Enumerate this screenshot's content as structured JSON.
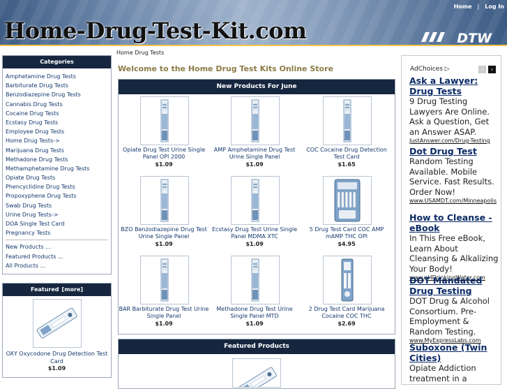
{
  "header": {
    "logo": "Home-Drug-Test-Kit.com",
    "links": [
      "Home",
      "Log In"
    ],
    "separator": "|",
    "brand_mark": "DTW"
  },
  "sidebar": {
    "categories_title": "Categories",
    "categories": [
      "Amphetamine Drug Tests",
      "Barbiturate Drug Tests",
      "Benzodiazepine Drug Tests",
      "Cannabis Drug Tests",
      "Cocaine Drug Tests",
      "Ecstasy Drug Tests",
      "Employee Drug Tests",
      "Home Drug Tests->",
      "Marijuana Drug Tests",
      "Methadone Drug Tests",
      "Methamphetamine Drug Tests",
      "Opiate Drug Tests",
      "Phencyclidine Drug Tests",
      "Propoxyphene Drug Tests",
      "Swab Drug Tests",
      "Urine Drug Tests->",
      "DOA Single Test Card",
      "Pregnancy Tests"
    ],
    "extra_links": [
      "New Products ...",
      "Featured Products ...",
      "All Products ..."
    ],
    "featured_title": "Featured",
    "featured_more": "[more]",
    "featured_product": {
      "name": "OXY Oxycodone Drug Detection Test Card",
      "price": "$1.09"
    }
  },
  "main": {
    "breadcrumb": "Home Drug Tests",
    "welcome": "Welcome to the Home Drug Test Kits Online Store",
    "new_products_title": "New Products For June",
    "products": [
      {
        "name": "Opiate Drug Test Urine Single Panel OPI 2000",
        "price": "$1.09"
      },
      {
        "name": "AMP Amphetamine Drug Test Urine Single Panel",
        "price": "$1.09"
      },
      {
        "name": "COC Cocaine Drug Detection Test Card",
        "price": "$1.65"
      },
      {
        "name": "BZO Benzodiazepine Drug Test Urine Single Panel",
        "price": "$1.09"
      },
      {
        "name": "Ecstasy Drug Test Urine Single Panel MDMA XTC",
        "price": "$1.09"
      },
      {
        "name": "5 Drug Test Card COC AMP mAMP THC OPI",
        "price": "$4.95"
      },
      {
        "name": "BAR Barbiturate Drug Test Urine Single Panel",
        "price": "$1.09"
      },
      {
        "name": "Methadone Drug Test Urine Single Panel MTD",
        "price": "$1.09"
      },
      {
        "name": "2 Drug Test Card Marijuana Cocaine COC THC",
        "price": "$2.69"
      }
    ],
    "featured_products_title": "Featured Products"
  },
  "ads": {
    "adchoices": "AdChoices",
    "items": [
      {
        "title": "Ask a Lawyer: Drug Tests",
        "body": "9 Drug Testing Lawyers Are Online. Ask a Question, Get an Answer ASAP.",
        "url": "JustAnswer.com/Drug-Testing"
      },
      {
        "title": "Dot Drug Test",
        "body": "Random Testing Available. Mobile Service. Fast Results. Order Now!",
        "url": "www.USAMDT.com/Minneapolis"
      },
      {
        "title": "How to Cleanse - eBook",
        "body": "In This Free eBook, Learn About Cleansing & Alkalizing Your Body!",
        "url": "www.pHDrinkingWater.com"
      },
      {
        "title": "DOT Mandated Drug Testing",
        "body": "DOT Drug & Alcohol Consortium. Pre-Employment & Random Testing.",
        "url": "www.MyExpressLabs.com"
      },
      {
        "title": "Suboxone (Twin Cities)",
        "body": "Opiate Addiction treatment in a",
        "url": ""
      }
    ]
  }
}
